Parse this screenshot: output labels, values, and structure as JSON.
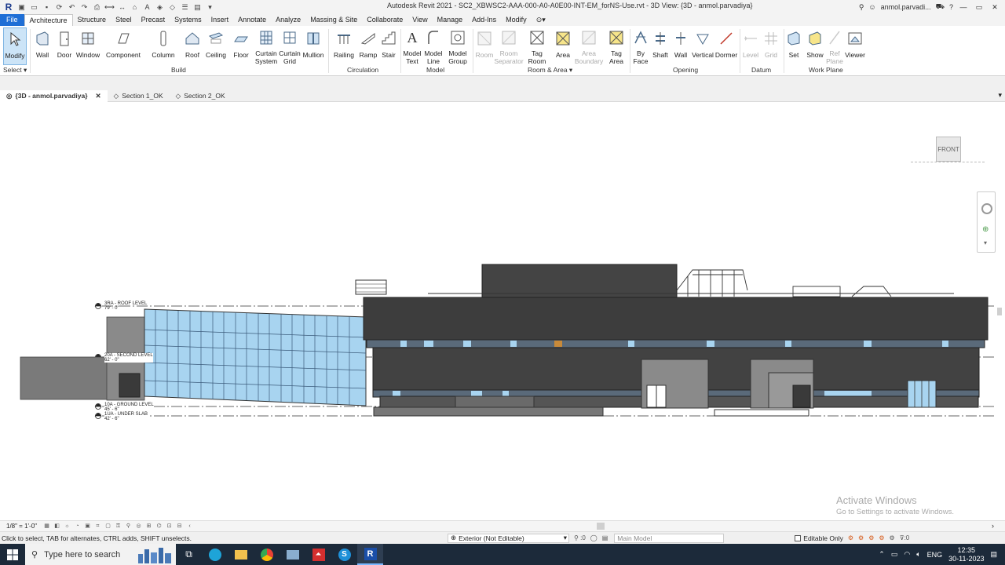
{
  "titlebar": {
    "app_letter": "R",
    "title": "Autodesk Revit 2021 - SC2_XBWSC2-AAA-000-A0-A0E00-INT-EM_forNS-Use.rvt - 3D View: {3D - anmol.parvadiya}",
    "user": "anmol.parvadi...",
    "controls": [
      "—",
      "▭",
      "✕"
    ]
  },
  "menu_tabs": [
    "File",
    "Architecture",
    "Structure",
    "Steel",
    "Precast",
    "Systems",
    "Insert",
    "Annotate",
    "Analyze",
    "Massing & Site",
    "Collaborate",
    "View",
    "Manage",
    "Add-Ins",
    "Modify"
  ],
  "active_tab": "Architecture",
  "ribbon": {
    "select": {
      "button": "Modify",
      "label": "Select ▾"
    },
    "build": {
      "label": "Build",
      "buttons": [
        "Wall",
        "Door",
        "Window",
        "Component",
        "Column",
        "Roof",
        "Ceiling",
        "Floor",
        "Curtain\nSystem",
        "Curtain\nGrid",
        "Mullion"
      ]
    },
    "circulation": {
      "label": "Circulation",
      "buttons": [
        "Railing",
        "Ramp",
        "Stair"
      ]
    },
    "model": {
      "label": "Model",
      "buttons": [
        "Model\nText",
        "Model\nLine",
        "Model\nGroup"
      ]
    },
    "room_area": {
      "label": "Room & Area ▾",
      "buttons": [
        "Room",
        "Room\nSeparator",
        "Tag\nRoom",
        "Area",
        "Area\nBoundary",
        "Tag\nArea"
      ]
    },
    "opening": {
      "label": "Opening",
      "buttons": [
        "By\nFace",
        "Shaft",
        "Wall",
        "Vertical",
        "Dormer"
      ]
    },
    "datum": {
      "label": "Datum",
      "buttons": [
        "Level",
        "Grid"
      ]
    },
    "work_plane": {
      "label": "Work Plane",
      "buttons": [
        "Set",
        "Show",
        "Ref\nPlane",
        "Viewer"
      ]
    }
  },
  "view_tabs": [
    {
      "label": "{3D - anmol.parvadiya}",
      "active": true
    },
    {
      "label": "Section 1_OK",
      "active": false
    },
    {
      "label": "Section 2_OK",
      "active": false
    }
  ],
  "viewcube": {
    "face": "FRONT"
  },
  "levels": [
    {
      "name": "3RA - ROOF LEVEL",
      "elev": "79' - 0\""
    },
    {
      "name": "20A - SECOND LEVEL",
      "elev": "62' - 0\""
    },
    {
      "name": "10A - GROUND LEVEL",
      "elev": "45' - 6\""
    },
    {
      "name": "1UA - UNDER SLAB",
      "elev": "42' - 6\""
    }
  ],
  "watermark": {
    "title": "Activate Windows",
    "subtitle": "Go to Settings to activate Windows."
  },
  "view_bar": {
    "scale": "1/8\" = 1'-0\""
  },
  "status": {
    "message": "Click to select, TAB for alternates, CTRL adds, SHIFT unselects.",
    "workset": "Exterior (Not Editable)",
    "selection_count": ":0",
    "model": "Main Model",
    "editable_only": "Editable Only",
    "filter_count": ":0"
  },
  "taskbar": {
    "search_placeholder": "Type here to search",
    "language": "ENG",
    "time": "12:35",
    "date": "30-11-2023"
  },
  "colors": {
    "file_tab": "#1f6fd6",
    "building_dark": "#3d3d3d",
    "glass": "#a8d4f0",
    "taskbar": "#1c2a3a"
  }
}
